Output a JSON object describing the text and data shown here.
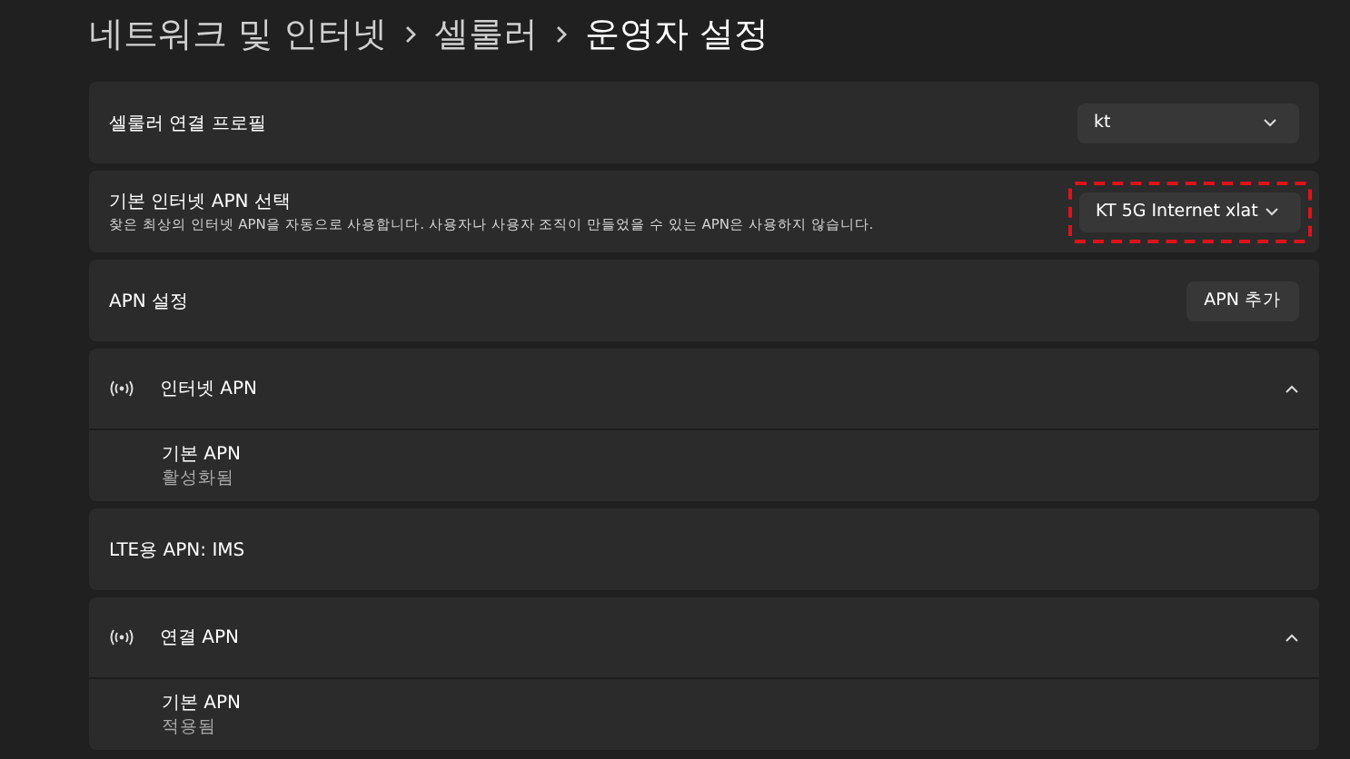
{
  "breadcrumb": [
    {
      "label": "네트워크 및 인터넷",
      "current": false
    },
    {
      "label": "셀룰러",
      "current": false
    },
    {
      "label": "운영자 설정",
      "current": true
    }
  ],
  "rows": [
    {
      "kind": "dropdown",
      "label": "셀룰러 연결 프로필",
      "value": "kt",
      "highlighted": false
    },
    {
      "kind": "dropdown",
      "label": "기본 인터넷 APN 선택",
      "description": "찾은 최상의 인터넷 APN을 자동으로 사용합니다. 사용자나 사용자 조직이 만들었을 수 있는 APN은 사용하지 않습니다.",
      "value": "KT 5G Internet xlat",
      "highlighted": true
    },
    {
      "kind": "button",
      "label": "APN 설정",
      "button": "APN 추가"
    },
    {
      "kind": "expander",
      "label": "인터넷 APN",
      "expanded": true,
      "children": [
        {
          "title": "기본 APN",
          "status": "활성화됨"
        }
      ]
    },
    {
      "kind": "plain",
      "label": "LTE용 APN: IMS"
    },
    {
      "kind": "expander",
      "label": "연결 APN",
      "expanded": true,
      "children": [
        {
          "title": "기본 APN",
          "status": "적용됨"
        }
      ]
    }
  ]
}
